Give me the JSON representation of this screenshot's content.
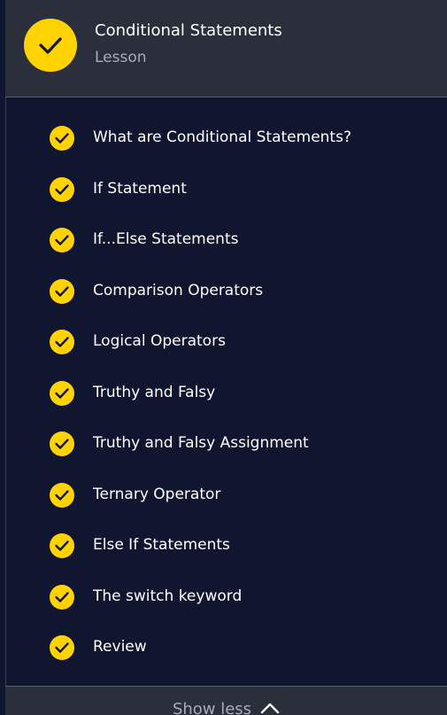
{
  "header": {
    "title": "Conditional Statements",
    "subtitle": "Lesson",
    "status_icon": "check-icon",
    "accent_color": "#ffd300"
  },
  "lessons": [
    {
      "label": "What are Conditional Statements?",
      "completed": true
    },
    {
      "label": "If Statement",
      "completed": true
    },
    {
      "label": "If...Else Statements",
      "completed": true
    },
    {
      "label": "Comparison Operators",
      "completed": true
    },
    {
      "label": "Logical Operators",
      "completed": true
    },
    {
      "label": "Truthy and Falsy",
      "completed": true
    },
    {
      "label": "Truthy and Falsy Assignment",
      "completed": true
    },
    {
      "label": "Ternary Operator",
      "completed": true
    },
    {
      "label": "Else If Statements",
      "completed": true
    },
    {
      "label": "The switch keyword",
      "completed": true
    },
    {
      "label": "Review",
      "completed": true
    }
  ],
  "footer": {
    "toggle_label": "Show less",
    "toggle_icon": "chevron-up-icon"
  },
  "colors": {
    "background": "#10162f",
    "header_background": "#2b2f3b",
    "check_fill": "#ffd300",
    "text": "#ffffff",
    "muted_text": "#a8acb8"
  }
}
